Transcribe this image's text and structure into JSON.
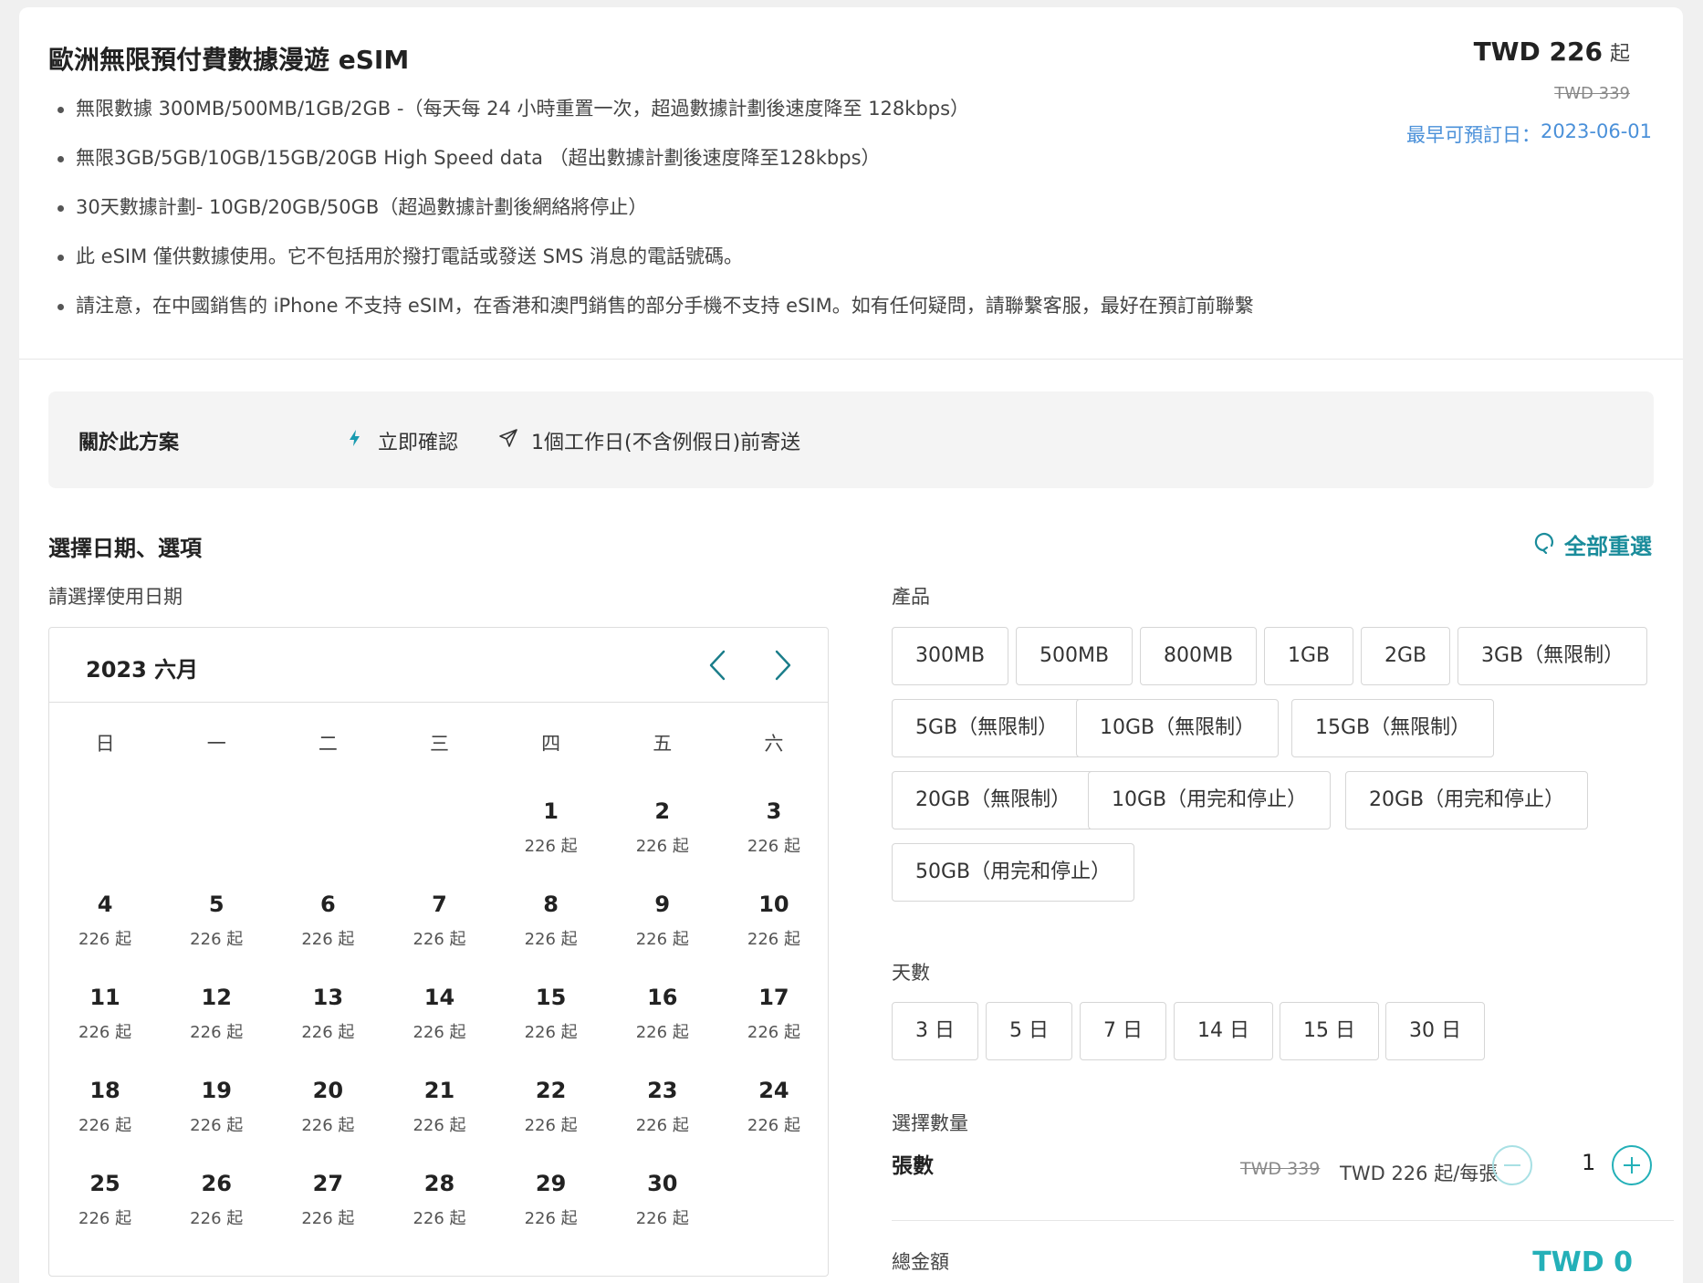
{
  "header": {
    "title": "歐洲無限預付費數據漫遊 eSIM",
    "bullets": [
      "無限數據 300MB/500MB/1GB/2GB -（每天每 24 小時重置一次，超過數據計劃後速度降至 128kbps）",
      "無限3GB/5GB/10GB/15GB/20GB High Speed data （超出數據計劃後速度降至128kbps）",
      "30天數據計劃- 10GB/20GB/50GB（超過數據計劃後網絡將停止）",
      "此 eSIM 僅供數據使用。它不包括用於撥打電話或發送 SMS 消息的電話號碼。",
      "請注意，在中國銷售的 iPhone 不支持 eSIM，在香港和澳門銷售的部分手機不支持 eSIM。如有任何疑問，請聯繫客服，最好在預訂前聯繫"
    ],
    "price": "TWD 226",
    "price_suffix": "起",
    "price_original": "TWD 339",
    "earliest_label": "最早可預訂日：",
    "earliest_date": "2023-06-01"
  },
  "about": {
    "title": "關於此方案",
    "instant": "立即確認",
    "delivery": "1個工作日(不含例假日)前寄送"
  },
  "selection": {
    "title": "選擇日期、選項",
    "reset": "全部重選",
    "date_label": "請選擇使用日期",
    "product_label": "產品",
    "days_label": "天數",
    "quantity_label": "選擇數量"
  },
  "calendar": {
    "month": "2023 六月",
    "weekdays": [
      "日",
      "一",
      "二",
      "三",
      "四",
      "五",
      "六"
    ],
    "price": "226 起",
    "days": [
      "1",
      "2",
      "3",
      "4",
      "5",
      "6",
      "7",
      "8",
      "9",
      "10",
      "11",
      "12",
      "13",
      "14",
      "15",
      "16",
      "17",
      "18",
      "19",
      "20",
      "21",
      "22",
      "23",
      "24",
      "25",
      "26",
      "27",
      "28",
      "29",
      "30"
    ]
  },
  "products": [
    "300MB",
    "500MB",
    "800MB",
    "1GB",
    "2GB",
    "3GB（無限制）",
    "5GB（無限制）",
    "10GB（無限制）",
    "15GB（無限制）",
    "20GB（無限制）",
    "10GB（用完和停止）",
    "20GB（用完和停止）",
    "50GB（用完和停止）"
  ],
  "days_options": [
    "3 日",
    "5 日",
    "7 日",
    "14 日",
    "15 日",
    "30 日"
  ],
  "quantity": {
    "label": "張數",
    "original": "TWD 339",
    "price": "TWD 226 起/每張",
    "value": "1"
  },
  "total": {
    "label": "總金額",
    "value": "TWD 0"
  },
  "colors": {
    "accent": "#24b0b8",
    "link": "#4a90d9",
    "nav": "#1a7d8a"
  }
}
